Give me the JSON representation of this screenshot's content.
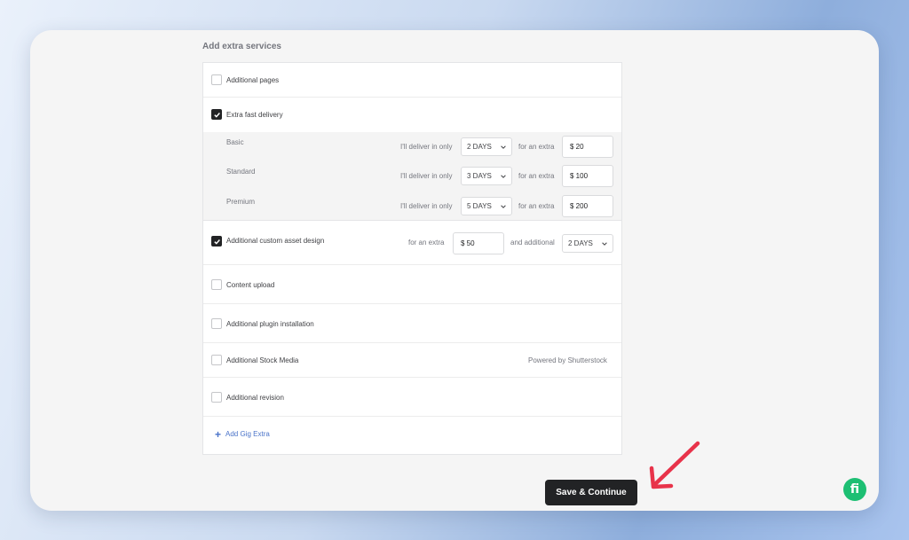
{
  "section_title": "Add extra services",
  "services": [
    {
      "label": "Additional pages",
      "checked": false
    },
    {
      "label": "Extra fast delivery",
      "checked": true
    },
    {
      "label": "Additional custom asset design",
      "checked": true
    },
    {
      "label": "Content upload",
      "checked": false
    },
    {
      "label": "Additional plugin installation",
      "checked": false
    },
    {
      "label": "Additional Stock Media",
      "checked": false
    },
    {
      "label": "Additional revision",
      "checked": false
    }
  ],
  "fast_delivery": {
    "deliver_label": "I'll deliver in only",
    "extra_label": "for an extra",
    "tiers": [
      {
        "name": "Basic",
        "days": "2 DAYS",
        "price": "$ 20"
      },
      {
        "name": "Standard",
        "days": "3 DAYS",
        "price": "$ 100"
      },
      {
        "name": "Premium",
        "days": "5 DAYS",
        "price": "$ 200"
      }
    ]
  },
  "custom_asset": {
    "extra_label": "for an extra",
    "price": "$ 50",
    "additional_label": "and additional",
    "days": "2 DAYS"
  },
  "stock_media_note": "Powered by Shutterstock",
  "add_gig_extra": {
    "icon": "+",
    "label": "Add Gig Extra"
  },
  "save_button": "Save & Continue",
  "logo_letter": "fi",
  "colors": {
    "accent_green": "#1dbf73",
    "link_blue": "#4a73c9",
    "arrow_red": "#e8334a",
    "button_dark": "#222325"
  }
}
